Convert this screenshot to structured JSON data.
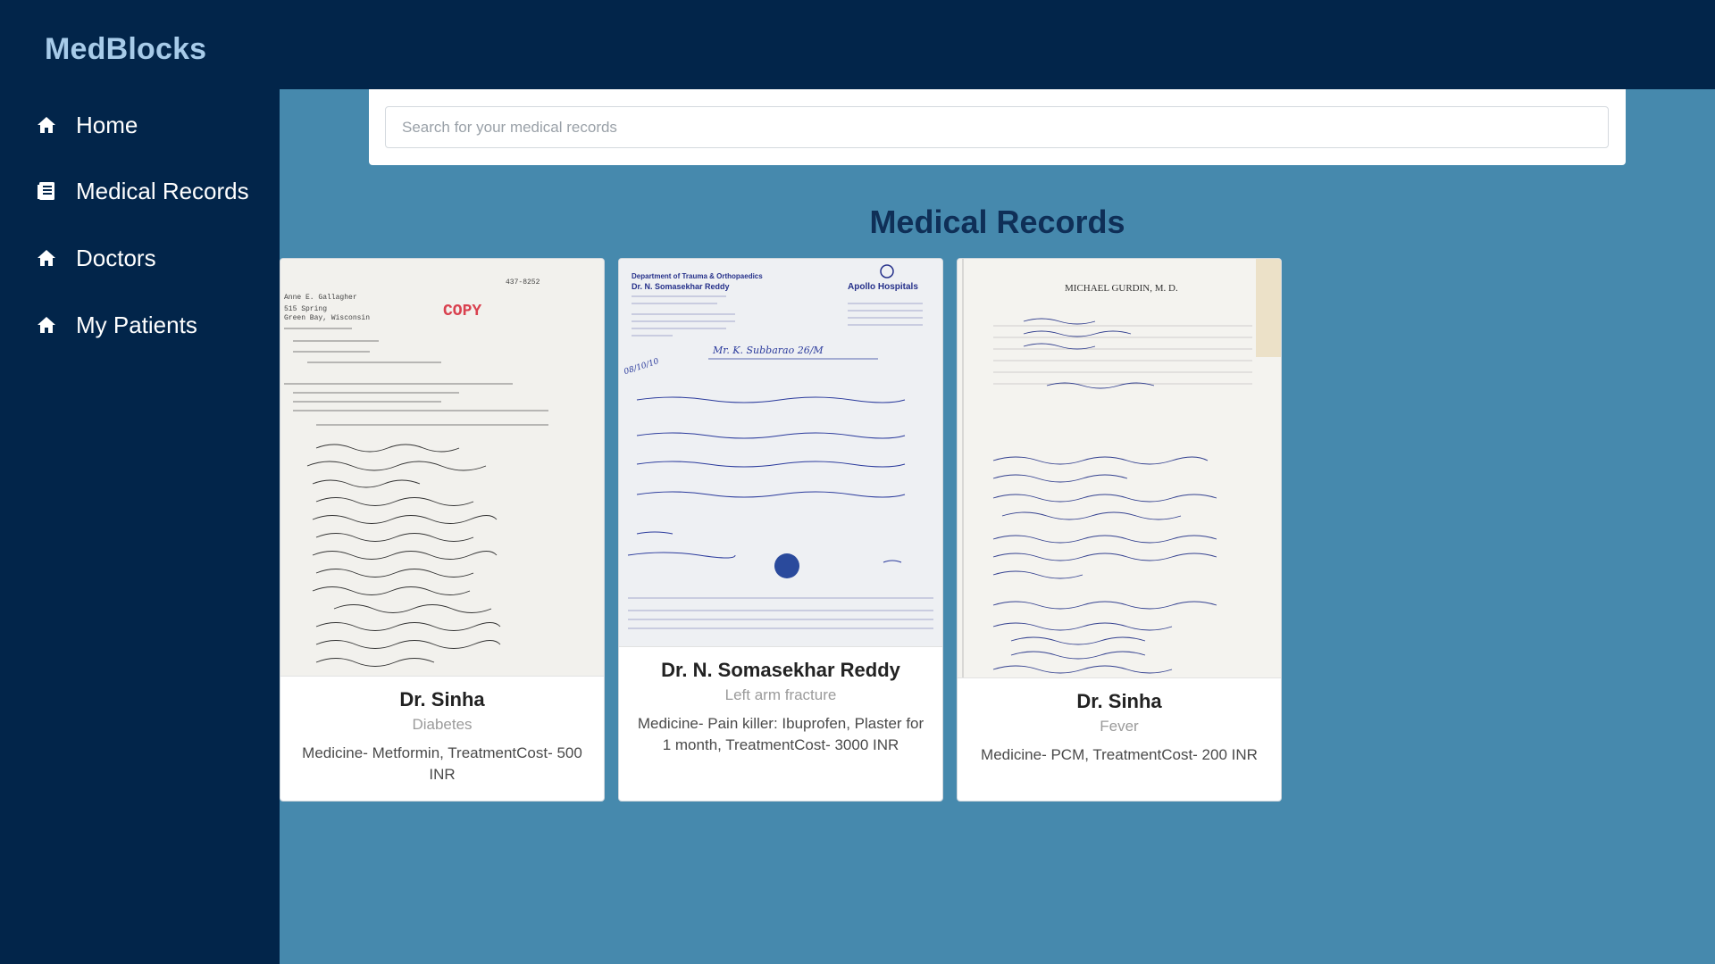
{
  "app": {
    "brand": "MedBlocks"
  },
  "sidebar": {
    "items": [
      {
        "label": "Home",
        "icon": "home-icon"
      },
      {
        "label": "Medical Records",
        "icon": "records-icon"
      },
      {
        "label": "Doctors",
        "icon": "home-icon"
      },
      {
        "label": "My Patients",
        "icon": "home-icon"
      }
    ]
  },
  "search": {
    "placeholder": "Search for your medical records",
    "value": ""
  },
  "main": {
    "title": "Medical Records"
  },
  "records": [
    {
      "doctor": "Dr. Sinha",
      "diagnosis": "Diabetes",
      "details": "Medicine- Metformin, TreatmentCost- 500 INR"
    },
    {
      "doctor": "Dr. N. Somasekhar Reddy",
      "diagnosis": "Left arm fracture",
      "details": "Medicine- Pain killer: Ibuprofen, Plaster for 1 month, TreatmentCost- 3000 INR"
    },
    {
      "doctor": "Dr. Sinha",
      "diagnosis": "Fever",
      "details": "Medicine- PCM, TreatmentCost- 200 INR"
    }
  ],
  "prescriptions": {
    "first": {
      "stamp": "COPY",
      "patient": "Anne E. Gallagher",
      "phone": "437-8252",
      "address": "515 Spring",
      "city": "Green Bay, Wisconsin"
    },
    "second": {
      "department": "Department of Trauma & Orthopaedics",
      "doctor": "Dr. N. Somasekhar Reddy",
      "hospital": "Apollo Hospitals",
      "patient": "Mr. K. Subbarao  26/M",
      "date": "08/10/10"
    },
    "third": {
      "header": "MICHAEL GURDIN, M. D."
    }
  },
  "colors": {
    "navy": "#02254a",
    "brand": "#a7cbe9",
    "main_bg": "#4689ad",
    "title": "#0f2f57"
  }
}
